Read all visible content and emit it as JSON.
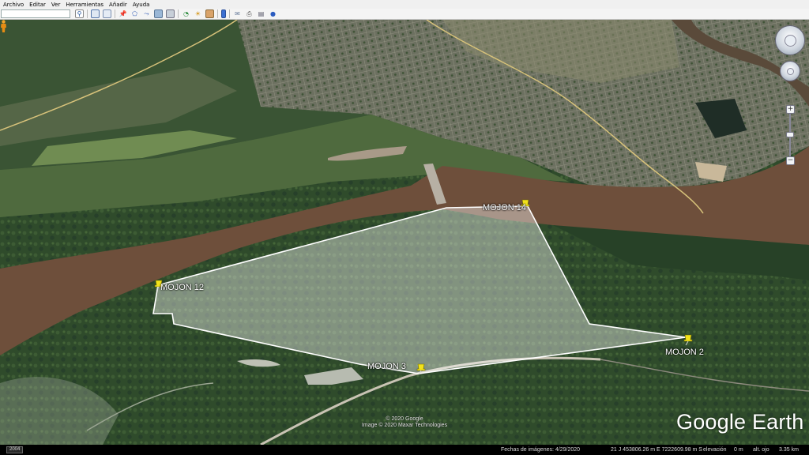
{
  "menu": [
    "Archivo",
    "Editar",
    "Ver",
    "Herramientas",
    "Añadir",
    "Ayuda"
  ],
  "toolbar": {
    "search_value": "",
    "buttons": [
      "search-icon",
      "sidebar-icon",
      "overview-icon",
      "placemark-icon",
      "polygon-icon",
      "path-icon",
      "image-overlay-icon",
      "record-tour-icon",
      "historical-imagery-icon",
      "sun-icon",
      "planets-icon",
      "ruler-icon",
      "email-icon",
      "print-icon",
      "save-image-icon",
      "maps-icon"
    ]
  },
  "map": {
    "placemarks": [
      {
        "name": "MOJON 14"
      },
      {
        "name": "MOJON 12"
      },
      {
        "name": "MOJON 3"
      },
      {
        "name": "MOJON 2"
      }
    ],
    "attribution": [
      "© 2020 Google",
      "Image © 2020 Maxar Technologies"
    ],
    "logo": "Google Earth",
    "polygon_color": "#ffffff",
    "pin_color": "#f2e21a"
  },
  "status": {
    "year": "2004",
    "imagery_date": "Fechas de imágenes: 4/29/2020",
    "coords": "21 J 453806.26 m E 7222609.98 m S",
    "elevation_label": "elevación",
    "elevation": "0 m",
    "eye_alt_label": "alt. ojo",
    "eye_alt": "3.35 km"
  },
  "colors": {
    "river": "#6e4f3b",
    "vegetation": "#2e4b2a",
    "ui_bar": "#f0f0f0"
  }
}
